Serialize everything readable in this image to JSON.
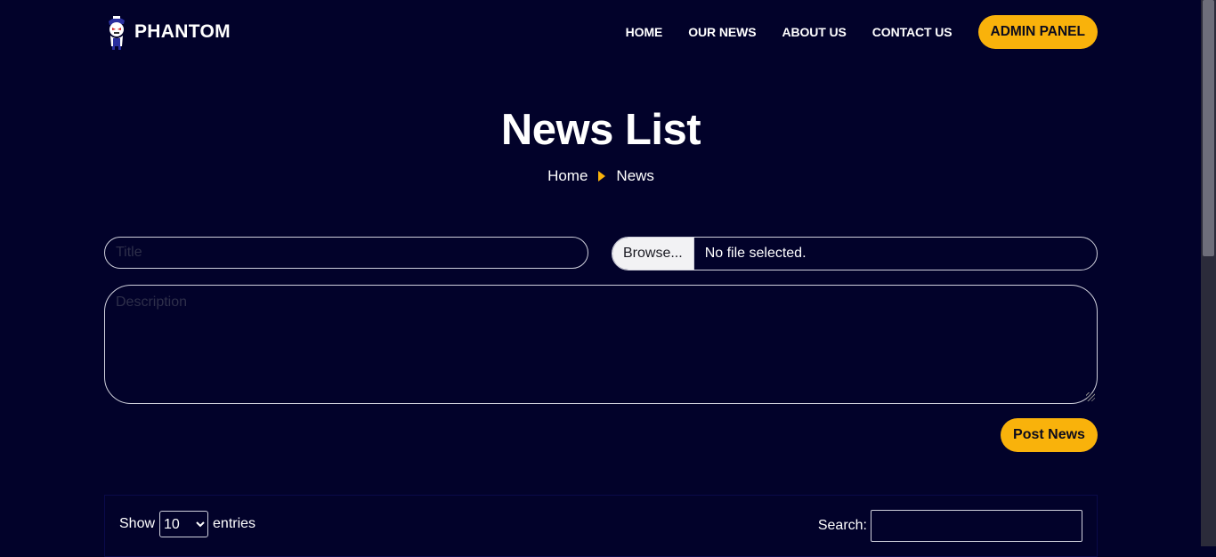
{
  "header": {
    "brand": "PHANTOM",
    "nav": [
      "HOME",
      "OUR NEWS",
      "ABOUT US",
      "CONTACT US"
    ],
    "admin_button": "ADMIN PANEL"
  },
  "hero": {
    "title": "News List",
    "breadcrumb": [
      "Home",
      "News"
    ]
  },
  "form": {
    "title_placeholder": "Title",
    "browse_label": "Browse...",
    "file_status": "No file selected.",
    "description_placeholder": "Description",
    "post_button": "Post News"
  },
  "table": {
    "show_label": "Show",
    "entries_value": "10",
    "entries_label": "entries",
    "search_label": "Search:"
  },
  "colors": {
    "background": "#02022a",
    "accent": "#f9b20b"
  }
}
